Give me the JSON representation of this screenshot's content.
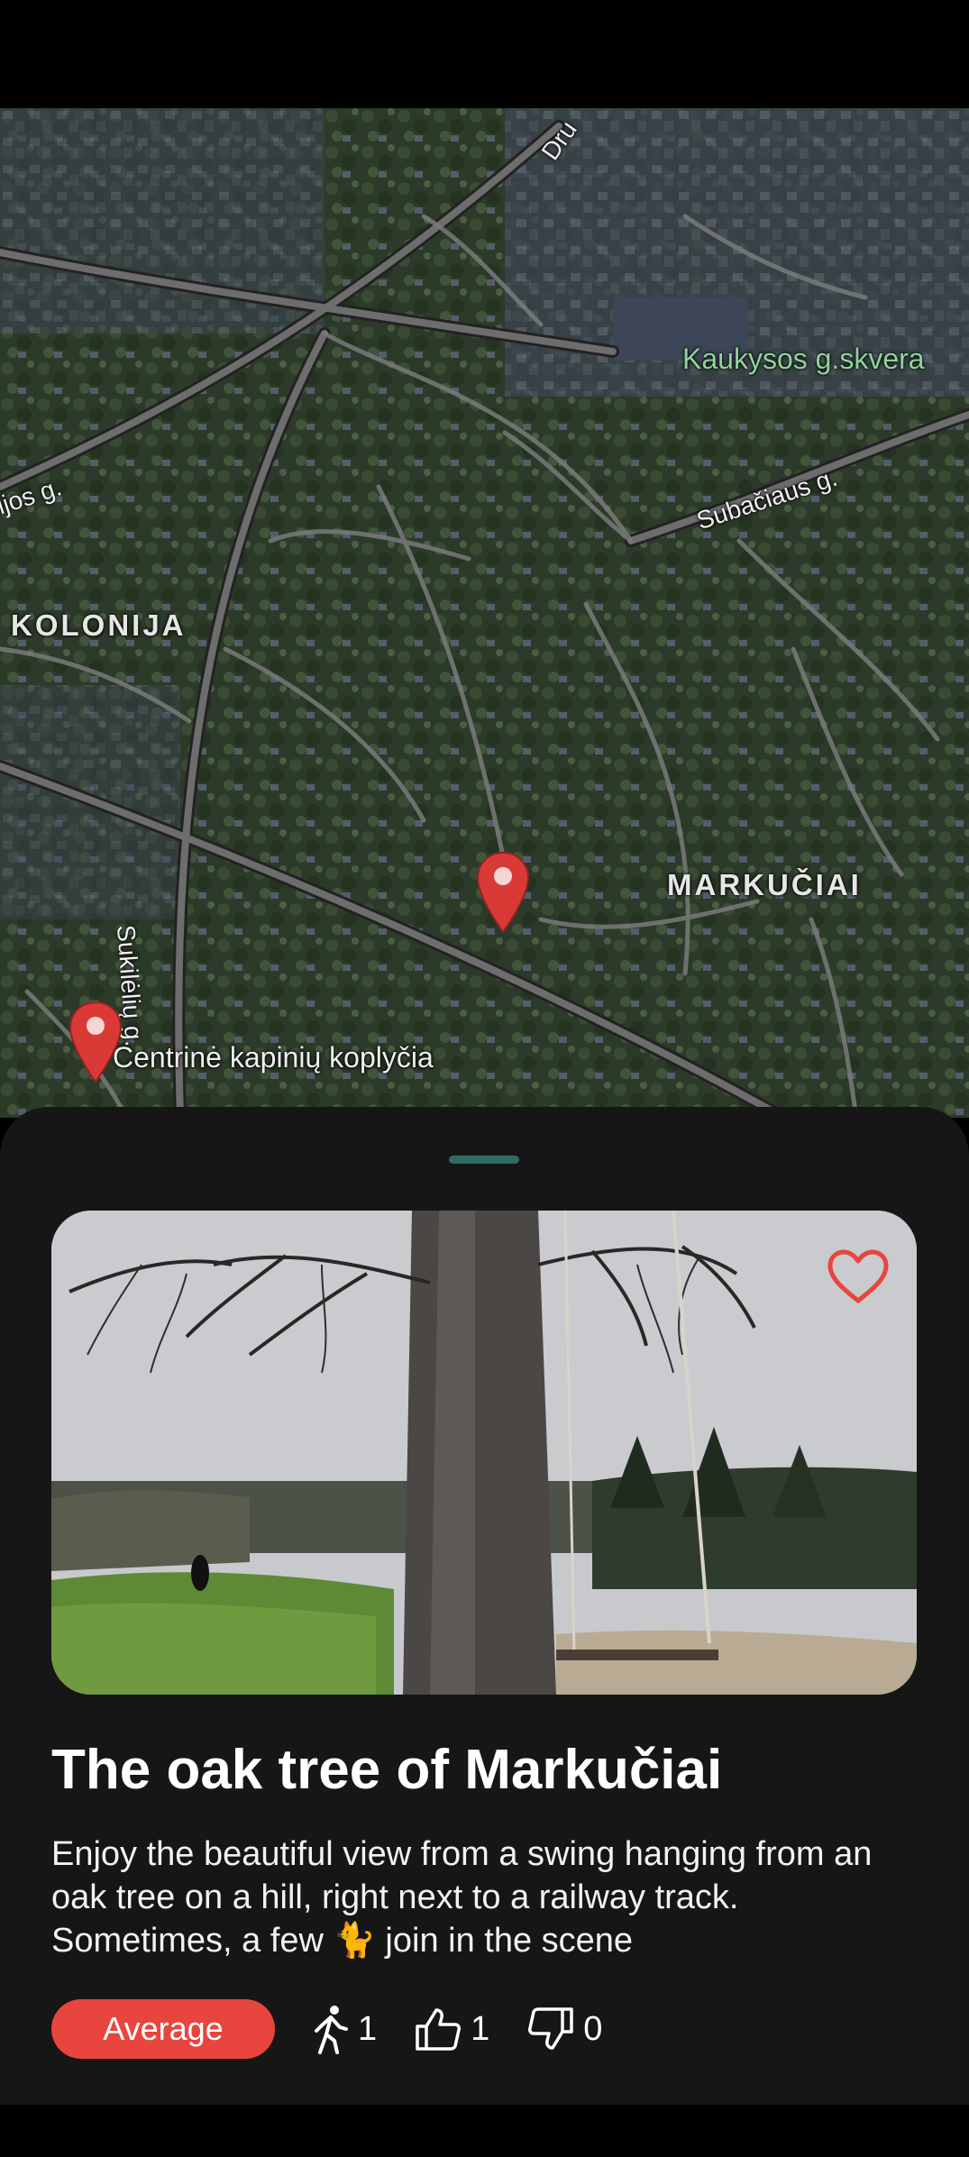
{
  "map": {
    "labels": {
      "street_druskininku": "Dru",
      "park": "Kaukysos g.skvera",
      "street_left": "ijos g.",
      "street_subaciaus": "Subačiaus g.",
      "district_kolonija": "KOLONIJA",
      "district_markuciai": "MARKUČIAI",
      "street_sukileliu": "Sukilėlių g.",
      "poi_chapel": "Centrinė kapinių koplyčia"
    },
    "pins": [
      {
        "name": "pin-markuciai-oak",
        "color": "#d93a36"
      },
      {
        "name": "pin-chapel",
        "color": "#d93a36"
      }
    ]
  },
  "place": {
    "title": "The oak tree of Markučiai",
    "description": "Enjoy the beautiful view from a swing hanging from an oak tree on a hill, right next to a railway track. Sometimes, a few 🐈 join in the scene",
    "rating_label": "Average",
    "visits": "1",
    "likes": "1",
    "dislikes": "0",
    "favorite_icon": "heart-outline-icon",
    "accent_color": "#e8453e"
  }
}
